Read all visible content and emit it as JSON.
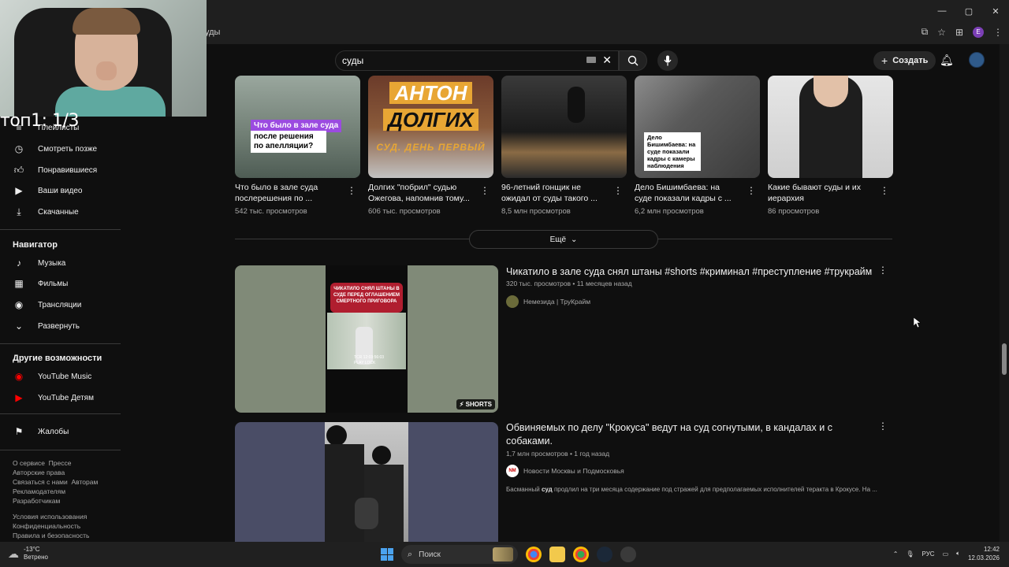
{
  "browser": {
    "address": "уды",
    "window_buttons": [
      "—",
      "▢",
      "✕"
    ],
    "profile_initial": "E"
  },
  "overlay": {
    "counter": "топ1: 1/3"
  },
  "header": {
    "search_value": "суды",
    "create_label": "Создать"
  },
  "sidebar": {
    "you_items": [
      {
        "label": "Плейлисты",
        "icon": "playlist-icon"
      },
      {
        "label": "Смотреть позже",
        "icon": "clock-icon"
      },
      {
        "label": "Понравившиеся",
        "icon": "thumb-up-icon"
      },
      {
        "label": "Ваши видео",
        "icon": "video-icon"
      },
      {
        "label": "Скачанные",
        "icon": "download-icon"
      }
    ],
    "nav_heading": "Навигатор",
    "nav_items": [
      {
        "label": "Музыка",
        "icon": "music-icon"
      },
      {
        "label": "Фильмы",
        "icon": "film-icon"
      },
      {
        "label": "Трансляции",
        "icon": "live-icon"
      },
      {
        "label": "Развернуть",
        "icon": "chevron-down-icon"
      }
    ],
    "other_heading": "Другие возможности",
    "other_items": [
      {
        "label": "YouTube Music",
        "icon": "youtube-music-icon"
      },
      {
        "label": "YouTube Детям",
        "icon": "youtube-kids-icon"
      }
    ],
    "report_label": "Жалобы",
    "footer1": [
      "О сервисе",
      "Прессе",
      "Авторские права",
      "Связаться с нами",
      "Авторам",
      "Рекламодателям",
      "Разработчикам"
    ],
    "footer2": [
      "Условия использования",
      "Конфиденциальность",
      "Правила и безопасность"
    ]
  },
  "cards": [
    {
      "title1": "Что было в зале суда",
      "title2": "послерешения по ...",
      "views": "542 тыс. просмотров",
      "overlay1": "Что было в зале суда",
      "overlay2": "после решения",
      "overlay3": "по апелляции?"
    },
    {
      "title1": "Долгих \"побрил\" судью",
      "title2": "Ожегова, напомнив тому...",
      "views": "606 тыс. просмотров",
      "overlay1": "АНТОН",
      "overlay2": "ДОЛГИХ",
      "overlay3": "СУД. ДЕНЬ ПЕРВЫЙ"
    },
    {
      "title1": "96-летний гонщик не",
      "title2": "ожидал от суды такого ...",
      "views": "8,5 млн просмотров"
    },
    {
      "title1": "Дело Бишимбаева: на",
      "title2": "суде показали кадры с ...",
      "views": "6,2 млн просмотров",
      "overlay1": "Дело Бишимбаева: на суде показали кадры с камеры наблюдения"
    },
    {
      "title1": "Какие бывают суды и их",
      "title2": "иерархия",
      "views": "86 просмотров"
    }
  ],
  "more_label": "Ещё",
  "results": [
    {
      "title": "Чикатило в зале суда снял штаны #shorts #криминал #преступление #трукрайм",
      "meta": "320 тыс. просмотров • 11 месяцев назад",
      "channel": "Немезида | ТруКрайм",
      "badge": "SHORTS",
      "overlay": "ЧИКАТИЛО СНЯЛ ШТАНЫ В СУДЕ ПЕРЕД ОГЛАШЕНИЕМ СМЕРТНОГО ПРИГОВОРА",
      "tc1": "TCR 12:03:56:03",
      "tc2": "PLAY    LOCK"
    },
    {
      "title1": "Обвиняемых по делу \"Крокуса\" ведут на суд согнутыми, в кандалах и с",
      "title2": "собаками.",
      "meta": "1,7 млн просмотров • 1 год назад",
      "channel": "Новости Москвы и Подмосковья",
      "channel_badge": "NM",
      "desc_pre": "Басманный ",
      "desc_bold": "суд",
      "desc_post": " продлил на три месяца содержание под стражей для предполагаемых исполнителей теракта в Крокусе. На ..."
    }
  ],
  "taskbar": {
    "temp": "-13°C",
    "weather": "Ветрено",
    "search_placeholder": "Поиск",
    "lang": "РУС",
    "time": "12:42",
    "date": "12.03.2026"
  },
  "colors": {
    "bg": "#0f0f0f",
    "accent_red": "#ff0000",
    "purple_overlay": "#9b4be0"
  }
}
